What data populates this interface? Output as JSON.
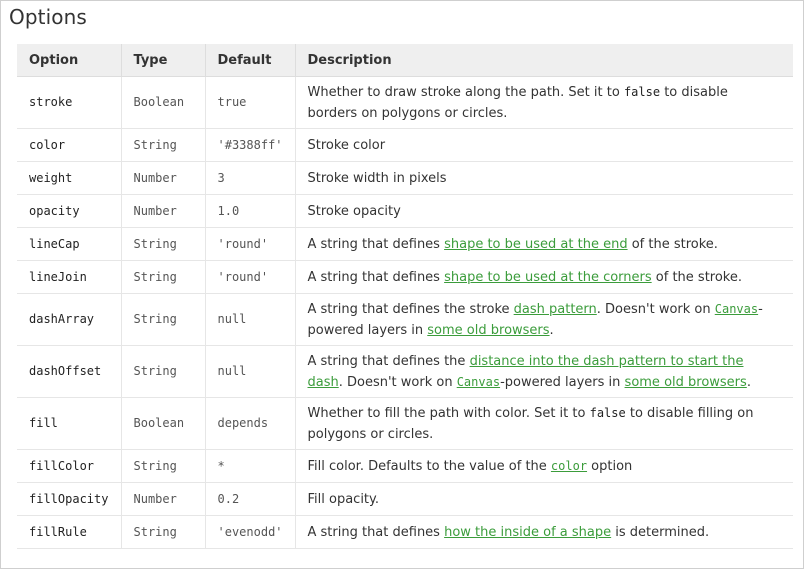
{
  "heading": "Options",
  "columns": [
    "Option",
    "Type",
    "Default",
    "Description"
  ],
  "link_color": "#3b9c3b",
  "rows": [
    {
      "name": "stroke",
      "type": "Boolean",
      "default": "true",
      "lines": 2,
      "desc": [
        {
          "t": "text",
          "v": "Whether to draw stroke along the path. Set it to "
        },
        {
          "t": "code",
          "v": "false"
        },
        {
          "t": "text",
          "v": " to disable borders on polygons or circles."
        }
      ]
    },
    {
      "name": "color",
      "type": "String",
      "default": "'#3388ff'",
      "lines": 1,
      "desc": [
        {
          "t": "text",
          "v": "Stroke color"
        }
      ]
    },
    {
      "name": "weight",
      "type": "Number",
      "default": "3",
      "lines": 1,
      "desc": [
        {
          "t": "text",
          "v": "Stroke width in pixels"
        }
      ]
    },
    {
      "name": "opacity",
      "type": "Number",
      "default": "1.0",
      "lines": 1,
      "desc": [
        {
          "t": "text",
          "v": "Stroke opacity"
        }
      ]
    },
    {
      "name": "lineCap",
      "type": "String",
      "default": "'round'",
      "lines": 1,
      "desc": [
        {
          "t": "text",
          "v": "A string that defines "
        },
        {
          "t": "link",
          "v": "shape to be used at the end"
        },
        {
          "t": "text",
          "v": " of the stroke."
        }
      ]
    },
    {
      "name": "lineJoin",
      "type": "String",
      "default": "'round'",
      "lines": 1,
      "desc": [
        {
          "t": "text",
          "v": "A string that defines "
        },
        {
          "t": "link",
          "v": "shape to be used at the corners"
        },
        {
          "t": "text",
          "v": " of the stroke."
        }
      ]
    },
    {
      "name": "dashArray",
      "type": "String",
      "default": "null",
      "lines": 2,
      "desc": [
        {
          "t": "text",
          "v": "A string that defines the stroke "
        },
        {
          "t": "link",
          "v": "dash pattern"
        },
        {
          "t": "text",
          "v": ". Doesn't work on "
        },
        {
          "t": "codelink",
          "v": "Canvas"
        },
        {
          "t": "text",
          "v": "-powered layers in "
        },
        {
          "t": "link",
          "v": "some old browsers"
        },
        {
          "t": "text",
          "v": "."
        }
      ]
    },
    {
      "name": "dashOffset",
      "type": "String",
      "default": "null",
      "lines": 2,
      "desc": [
        {
          "t": "text",
          "v": "A string that defines the "
        },
        {
          "t": "link",
          "v": "distance into the dash pattern to start the dash"
        },
        {
          "t": "text",
          "v": ". Doesn't work on "
        },
        {
          "t": "codelink",
          "v": "Canvas"
        },
        {
          "t": "text",
          "v": "-powered layers in "
        },
        {
          "t": "link",
          "v": "some old browsers"
        },
        {
          "t": "text",
          "v": "."
        }
      ]
    },
    {
      "name": "fill",
      "type": "Boolean",
      "default": "depends",
      "lines": 2,
      "desc": [
        {
          "t": "text",
          "v": "Whether to fill the path with color. Set it to "
        },
        {
          "t": "code",
          "v": "false"
        },
        {
          "t": "text",
          "v": " to disable filling on polygons or circles."
        }
      ]
    },
    {
      "name": "fillColor",
      "type": "String",
      "default": "*",
      "lines": 1,
      "desc": [
        {
          "t": "text",
          "v": "Fill color. Defaults to the value of the "
        },
        {
          "t": "codelink",
          "v": "color"
        },
        {
          "t": "text",
          "v": " option"
        }
      ]
    },
    {
      "name": "fillOpacity",
      "type": "Number",
      "default": "0.2",
      "lines": 1,
      "desc": [
        {
          "t": "text",
          "v": "Fill opacity."
        }
      ]
    },
    {
      "name": "fillRule",
      "type": "String",
      "default": "'evenodd'",
      "lines": 1,
      "desc": [
        {
          "t": "text",
          "v": "A string that defines "
        },
        {
          "t": "link",
          "v": "how the inside of a shape"
        },
        {
          "t": "text",
          "v": " is determined."
        }
      ]
    }
  ]
}
